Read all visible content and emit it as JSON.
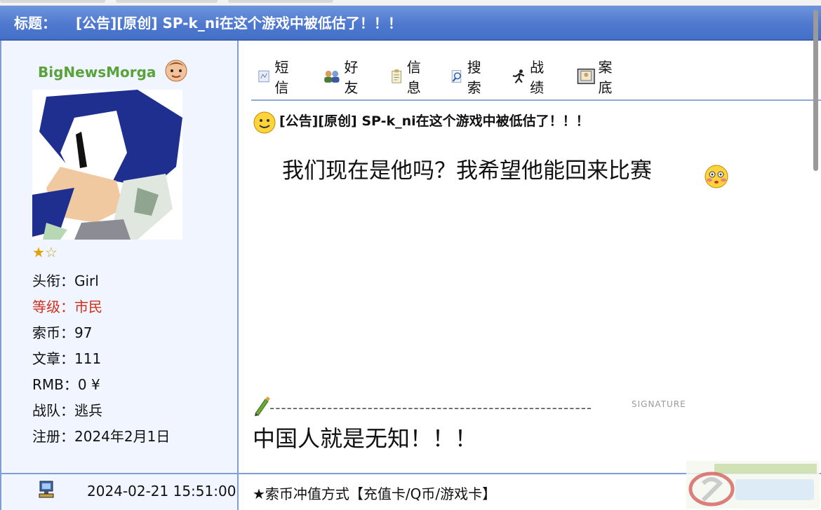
{
  "title_bar": {
    "label": "标题：",
    "title": "[公告][原创] SP-k_ni在这个游戏中被低估了！！！"
  },
  "user": {
    "name": "BigNewsMorga",
    "stars": {
      "filled": 1,
      "total": 2
    },
    "fields": [
      {
        "label": "头衔：",
        "value": "Girl"
      },
      {
        "label": "等级：",
        "value": "市民"
      },
      {
        "label": "索币：",
        "value": "97"
      },
      {
        "label": "文章：",
        "value": "111"
      },
      {
        "label": "RMB：",
        "value": "0 ¥"
      },
      {
        "label": "战队：",
        "value": "逃兵"
      },
      {
        "label": "注册：",
        "value": "2024年2月1日"
      }
    ]
  },
  "toolbar": {
    "items": [
      {
        "label": "短信",
        "icon": "message-icon"
      },
      {
        "label": "好友",
        "icon": "friends-icon"
      },
      {
        "label": "信息",
        "icon": "info-icon"
      },
      {
        "label": "搜索",
        "icon": "search-icon"
      },
      {
        "label": "战绩",
        "icon": "record-icon"
      },
      {
        "label": "案底",
        "icon": "file-icon"
      }
    ]
  },
  "post": {
    "title": "[公告][原创] SP-k_ni在这个游戏中被低估了！！！",
    "content": "我们现在是他吗？我希望他能回来比赛",
    "signature_word": "SIGNATURE",
    "signature": "中国人就是无知！！！"
  },
  "footer": {
    "timestamp": "2024-02-21 15:51:00",
    "promo": "★索币冲值方式【充值卡/Q币/游戏卡】"
  },
  "colors": {
    "title_bar": "#4f79cf",
    "username": "#5aa23a",
    "level": "#d0301c",
    "border": "#7f9ed6"
  }
}
